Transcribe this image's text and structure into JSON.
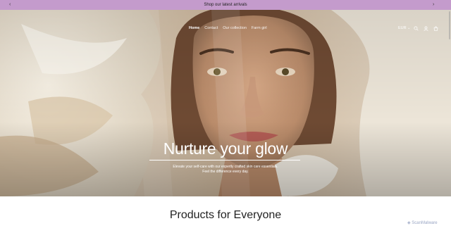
{
  "announcement": {
    "text": "Shop our latest arrivals"
  },
  "nav": {
    "items": [
      "Home",
      "Contact",
      "Our collection",
      "Farm girl"
    ]
  },
  "header": {
    "currency": "EUR"
  },
  "hero": {
    "headline": "Nurture your glow",
    "subtext_line1": "Elevate your self-care with our expertly crafted skin care essentials.",
    "subtext_line2": "Feel the difference every day."
  },
  "section": {
    "title": "Products for Everyone"
  },
  "watermark": {
    "text": "ScanMalware"
  },
  "colors": {
    "announcement_bg": "#c49bcc",
    "hero_text": "#ffffff"
  }
}
